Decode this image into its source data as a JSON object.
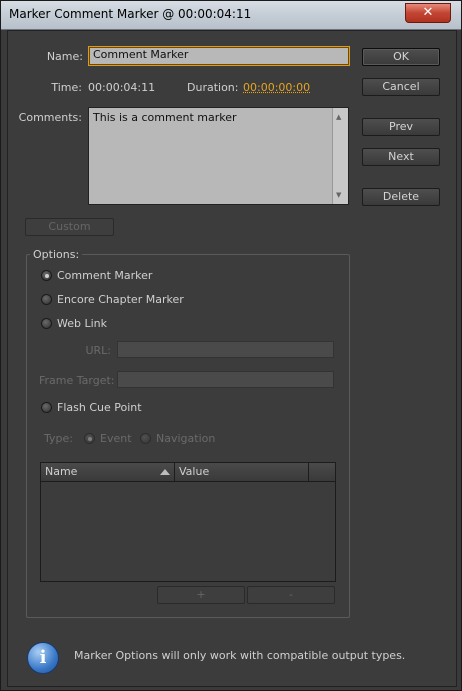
{
  "window": {
    "title": "Marker Comment Marker @ 00:00:04:11",
    "close_glyph": "✕"
  },
  "form": {
    "name_label": "Name:",
    "name_value": "Comment Marker",
    "time_label": "Time:",
    "time_value": "00:00:04:11",
    "duration_label": "Duration:",
    "duration_value": "00:00:00:00",
    "comments_label": "Comments:",
    "comments_value": "This is a comment marker",
    "custom_label": "Custom"
  },
  "buttons": {
    "ok": "OK",
    "cancel": "Cancel",
    "prev": "Prev",
    "next": "Next",
    "delete": "Delete"
  },
  "options": {
    "legend": "Options:",
    "comment_marker": "Comment Marker",
    "chapter_marker": "Encore Chapter Marker",
    "web_link": "Web Link",
    "url_label": "URL:",
    "frame_target_label": "Frame Target:",
    "flash_cue_point": "Flash Cue Point",
    "type_label": "Type:",
    "type_event": "Event",
    "type_navigation": "Navigation",
    "selected": "Comment Marker"
  },
  "table": {
    "columns": [
      "Name",
      "Value"
    ],
    "add_label": "+",
    "remove_label": "-"
  },
  "footer": {
    "icon": "info-icon",
    "icon_glyph": "i",
    "message": "Marker Options will only work with compatible output types."
  },
  "colors": {
    "accent": "#e4a420",
    "background": "#3c3c3c"
  }
}
